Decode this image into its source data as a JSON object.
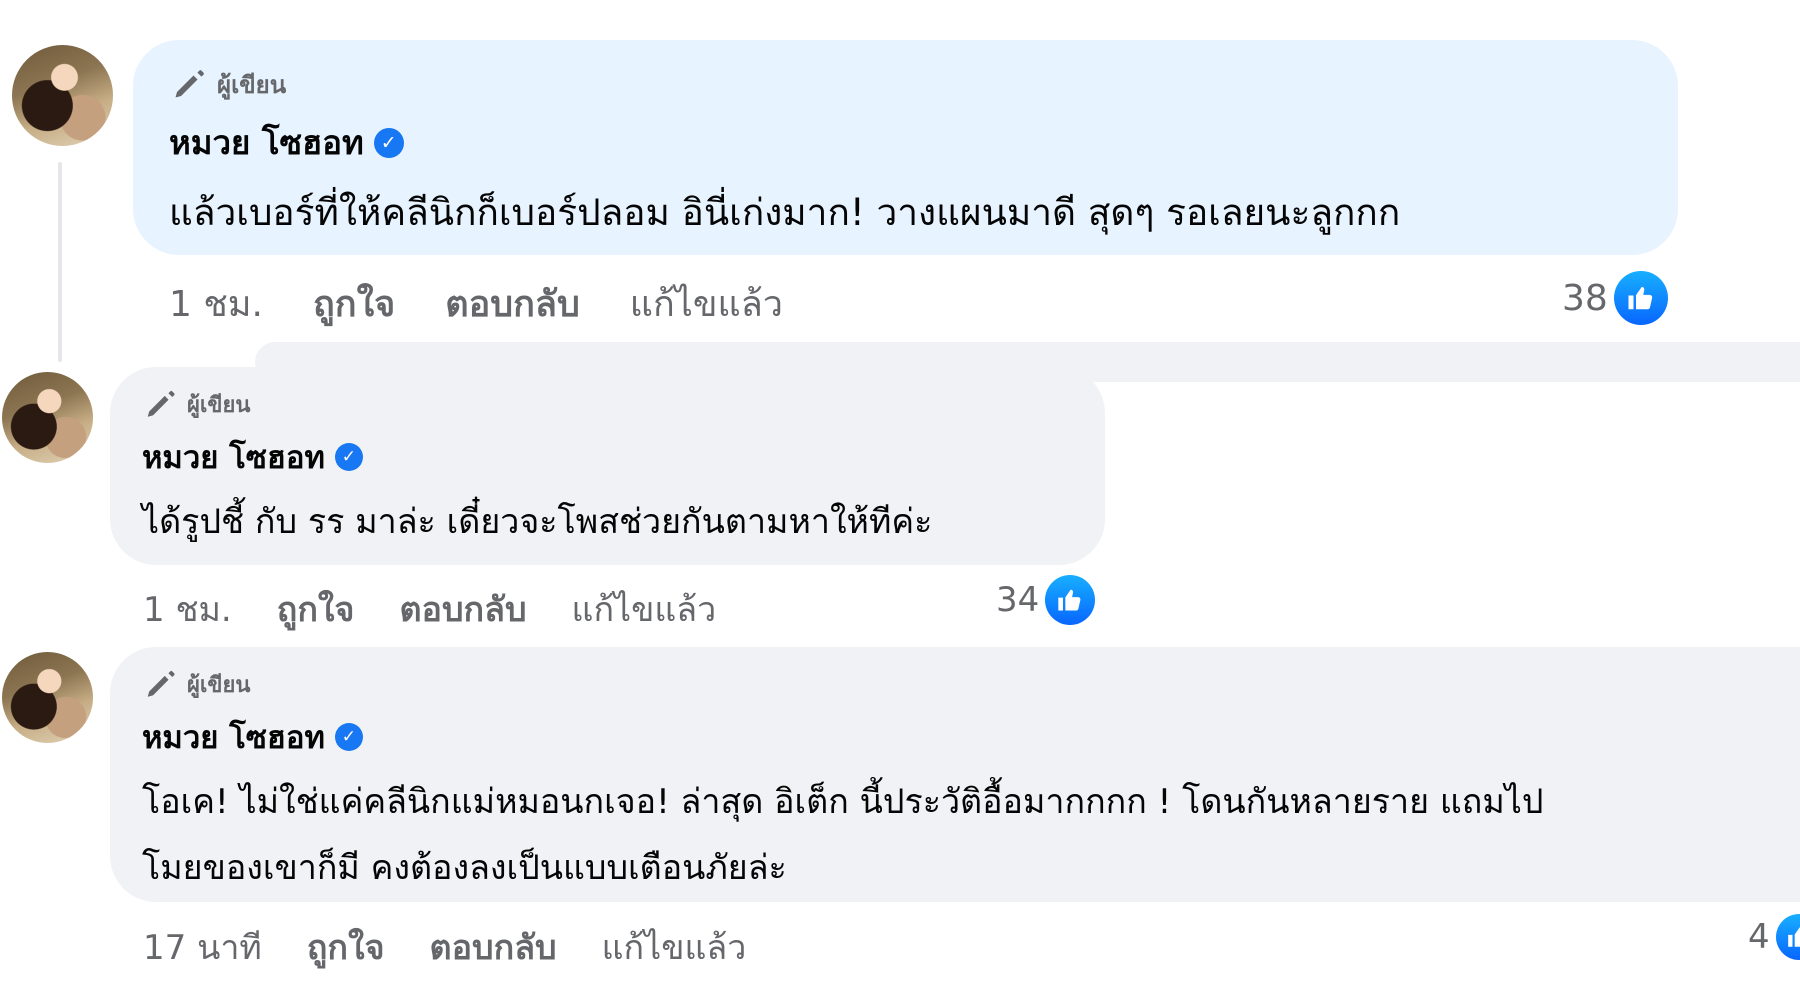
{
  "comments": [
    {
      "author_label": "ผู้เขียน",
      "name": "หมวย โซฮอท",
      "text": "แล้วเบอร์ที่ให้คลีนิกก็เบอร์ปลอม อินี่เก่งมาก! วางแผนมาดี สุดๆ รอเลยนะลูกกก",
      "time": "1 ชม.",
      "like": "ถูกใจ",
      "reply": "ตอบกลับ",
      "edited": "แก้ไขแล้ว",
      "reactions": "38"
    },
    {
      "author_label": "ผู้เขียน",
      "name": "หมวย โซฮอท",
      "text": "ได้รูปชี้ กับ รร มาล่ะ เดี๋ยวจะโพสช่วยกันตามหาให้ทีค่ะ",
      "time": "1 ชม.",
      "like": "ถูกใจ",
      "reply": "ตอบกลับ",
      "edited": "แก้ไขแล้ว",
      "reactions": "34"
    },
    {
      "author_label": "ผู้เขียน",
      "name": "หมวย โซฮอท",
      "text_line1": "โอเค! ไม่ใช่แค่คลีนิกแม่หมอนกเจอ! ล่าสุด อิเต็ก นี้ประวัติอื้อมากกกก ! โดนกันหลายราย แถมไป",
      "text_line2": "โมยของเขาก็มี คงต้องลงเป็นแบบเตือนภัยล่ะ",
      "time": "17 นาที",
      "like": "ถูกใจ",
      "reply": "ตอบกลับ",
      "edited": "แก้ไขแล้ว",
      "reactions": "4"
    }
  ],
  "icons": {
    "author": "pencil-icon",
    "verified": "verified-badge-icon",
    "reaction": "like-thumb-icon"
  },
  "colors": {
    "active_bubble": "#e7f3ff",
    "bubble": "#f0f2f5",
    "verified_blue": "#1877f2",
    "secondary_text": "#65676b"
  }
}
